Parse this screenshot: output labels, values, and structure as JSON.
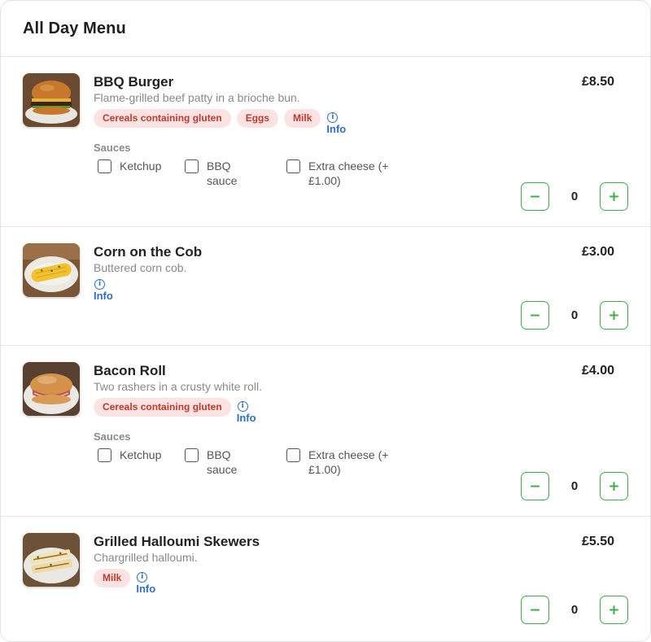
{
  "menu": {
    "title": "All Day Menu",
    "items": [
      {
        "name": "BBQ Burger",
        "description": "Flame-grilled beef patty in a brioche bun.",
        "price": "£8.50",
        "allergens": [
          "Cereals containing gluten",
          "Eggs",
          "Milk"
        ],
        "info_label": "Info",
        "sauces_title": "Sauces",
        "sauces": [
          "Ketchup",
          "BBQ sauce",
          "Extra cheese (+ £1.00)"
        ],
        "quantity": "0",
        "image_icon": "burger-image"
      },
      {
        "name": "Corn on the Cob",
        "description": "Buttered corn cob.",
        "price": "£3.00",
        "allergens": [],
        "info_label": "Info",
        "quantity": "0",
        "image_icon": "corn-image"
      },
      {
        "name": "Bacon Roll",
        "description": "Two rashers in a crusty white roll.",
        "price": "£4.00",
        "allergens": [
          "Cereals containing gluten"
        ],
        "info_label": "Info",
        "sauces_title": "Sauces",
        "sauces": [
          "Ketchup",
          "BBQ sauce",
          "Extra cheese (+ £1.00)"
        ],
        "quantity": "0",
        "image_icon": "bacon-roll-image"
      },
      {
        "name": "Grilled Halloumi Skewers",
        "description": "Chargrilled halloumi.",
        "price": "£5.50",
        "allergens": [
          "Milk"
        ],
        "info_label": "Info",
        "quantity": "0",
        "image_icon": "halloumi-image"
      }
    ],
    "controls": {
      "minus_symbol": "−",
      "plus_symbol": "+",
      "info_symbol": "i"
    }
  },
  "colors": {
    "accent_green": "#3fae49",
    "allergen_bg": "#fbe3e3",
    "allergen_text": "#c0392b",
    "info_blue": "#2f6fc2"
  }
}
